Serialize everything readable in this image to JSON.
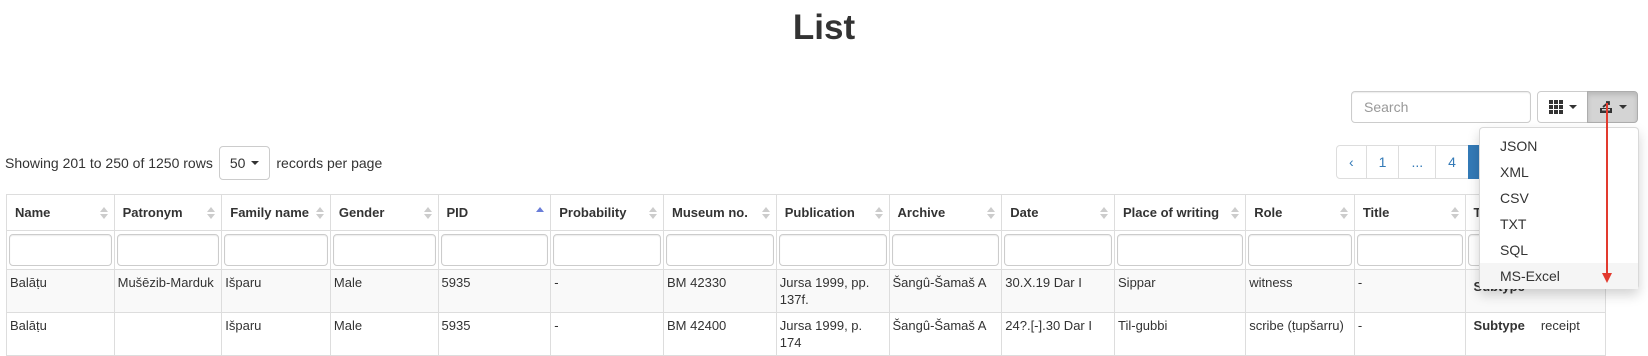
{
  "page": {
    "title": "List"
  },
  "toolbar": {
    "search_placeholder": "Search",
    "columns_icon": "grid-icon",
    "export_icon": "export-icon"
  },
  "export_menu": {
    "items": [
      "JSON",
      "XML",
      "CSV",
      "TXT",
      "SQL",
      "MS-Excel"
    ],
    "hovered": "MS-Excel"
  },
  "pagination_info": {
    "showing": "Showing 201 to 250 of 1250 rows",
    "page_size": "50",
    "suffix": "records per page"
  },
  "pagination": {
    "prev": "‹",
    "pages": [
      "1",
      "...",
      "4"
    ],
    "active": "5"
  },
  "table": {
    "columns": [
      "Name",
      "Patronym",
      "Family name",
      "Gender",
      "PID",
      "Probability",
      "Museum no.",
      "Publication",
      "Archive",
      "Date",
      "Place of writing",
      "Role",
      "Title",
      "Type"
    ],
    "sorted_column": "PID",
    "sort_direction": "asc",
    "rows": [
      {
        "name": "Balāṭu",
        "patronym": "Mušēzib-Marduk",
        "family": "Išparu",
        "gender": "Male",
        "pid": "5935",
        "probability": "-",
        "museum": "BM 42330",
        "publication": "Jursa 1999, pp. 137f.",
        "archive": "Šangû-Šamaš A",
        "date": "30.X.19 Dar I",
        "place": "Sippar",
        "role": "witness",
        "title": "-",
        "subtype_label": "Subtype",
        "subtype_value": ""
      },
      {
        "name": "Balāṭu",
        "patronym": "",
        "family": "Išparu",
        "gender": "Male",
        "pid": "5935",
        "probability": "-",
        "museum": "BM 42400",
        "publication": "Jursa 1999, p. 174",
        "archive": "Šangû-Šamaš A",
        "date": "24?.[-].30 Dar I",
        "place": "Til-gubbi",
        "role": "scribe (ṭupšarru)",
        "title": "-",
        "subtype_label": "Subtype",
        "subtype_value": "receipt"
      }
    ]
  },
  "colors": {
    "accent": "#337ab7",
    "annotation_arrow": "#e23a2e",
    "sort_active": "#6a7dd8"
  }
}
